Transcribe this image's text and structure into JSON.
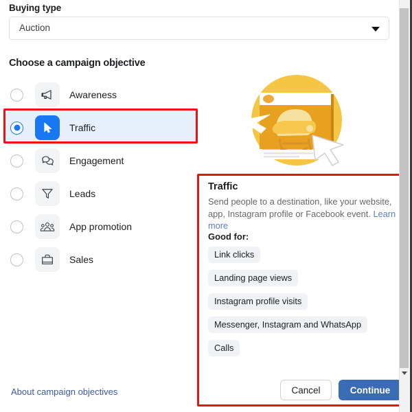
{
  "buying_type": {
    "label": "Buying type",
    "selected": "Auction",
    "caret_icon": "chevron-down-icon"
  },
  "objectives_section": {
    "title": "Choose a campaign objective",
    "items": [
      {
        "label": "Awareness",
        "icon": "megaphone-icon",
        "selected": false
      },
      {
        "label": "Traffic",
        "icon": "cursor-arrow-icon",
        "selected": true
      },
      {
        "label": "Engagement",
        "icon": "chat-bubbles-icon",
        "selected": false
      },
      {
        "label": "Leads",
        "icon": "funnel-icon",
        "selected": false
      },
      {
        "label": "App promotion",
        "icon": "people-group-icon",
        "selected": false
      },
      {
        "label": "Sales",
        "icon": "shopping-bag-icon",
        "selected": false
      }
    ],
    "about_link": "About campaign objectives"
  },
  "illustration": {
    "name": "traffic-objective-illustration",
    "circle_color": "#f4c643",
    "browser_color": "#e8a020",
    "cursor_color": "#ffffff"
  },
  "detail": {
    "title": "Traffic",
    "description": "Send people to a destination, like your website, app, Instagram profile or Facebook event.",
    "learn_more": "Learn more",
    "good_for_label": "Good for:",
    "tags": [
      "Link clicks",
      "Landing page views",
      "Instagram profile visits",
      "Messenger, Instagram and WhatsApp",
      "Calls"
    ],
    "cancel_label": "Cancel",
    "continue_label": "Continue"
  },
  "colors": {
    "accent_blue": "#1877f2",
    "button_blue": "#3a6bb5",
    "highlight_red": "#ee1111",
    "selected_row_bg": "#e7f0fa",
    "tag_bg": "#f0f2f5"
  }
}
